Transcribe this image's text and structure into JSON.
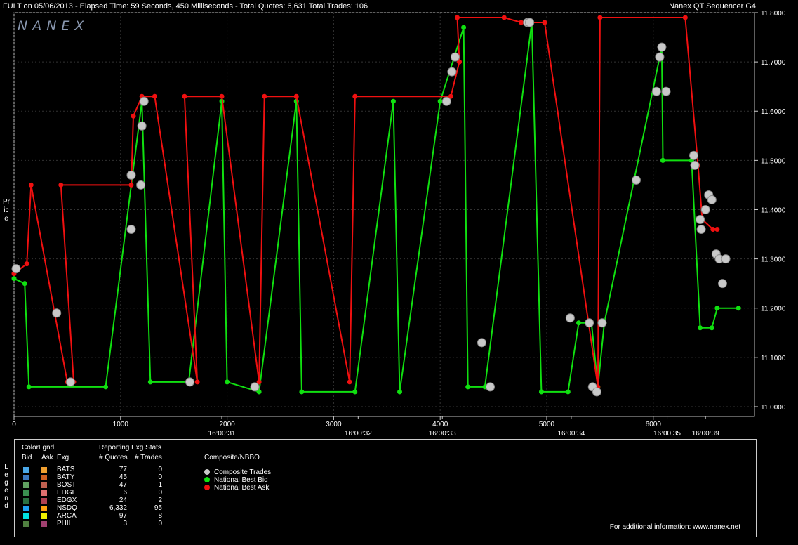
{
  "header": {
    "left": "FULT on 05/06/2013  -  Elapsed Time: 59 Seconds, 450 Milliseconds  -  Total Quotes: 6,631  Total Trades: 106",
    "right": "Nanex QT Sequencer G4",
    "logo": "NANEX"
  },
  "side_labels": {
    "price": "Price",
    "legend": "Legend"
  },
  "legend": {
    "colorlgnd": "ColorLgnd",
    "bid": "Bid",
    "ask": "Ask",
    "exg": "Exg",
    "stats_title": "Reporting Exg Stats",
    "quotes_hdr": "# Quotes",
    "trades_hdr": "# Trades",
    "composite_title": "Composite/NBBO",
    "exchanges": [
      {
        "name": "BATS",
        "quotes": "77",
        "trades": "0",
        "bid_color": "#4aa8e8",
        "ask_color": "#f0a030"
      },
      {
        "name": "BATY",
        "quotes": "45",
        "trades": "0",
        "bid_color": "#3a78c0",
        "ask_color": "#d06020"
      },
      {
        "name": "BOST",
        "quotes": "47",
        "trades": "1",
        "bid_color": "#60a060",
        "ask_color": "#c06050"
      },
      {
        "name": "EDGE",
        "quotes": "6",
        "trades": "0",
        "bid_color": "#3a9050",
        "ask_color": "#e07070"
      },
      {
        "name": "EDGX",
        "quotes": "24",
        "trades": "2",
        "bid_color": "#2a7040",
        "ask_color": "#b04050"
      },
      {
        "name": "NSDQ",
        "quotes": "6,332",
        "trades": "95",
        "bid_color": "#1ea0f0",
        "ask_color": "#ffa010"
      },
      {
        "name": "ARCA",
        "quotes": "97",
        "trades": "8",
        "bid_color": "#00e0e0",
        "ask_color": "#f0f000"
      },
      {
        "name": "PHIL",
        "quotes": "3",
        "trades": "0",
        "bid_color": "#508040",
        "ask_color": "#a04070"
      }
    ],
    "composite": [
      {
        "label": "Composite Trades",
        "color": "#c8c8c8"
      },
      {
        "label": "National Best Bid",
        "color": "#10e010"
      },
      {
        "label": "National Best Ask",
        "color": "#f01010"
      }
    ],
    "footer": "For additional information: www.nanex.net"
  },
  "chart_data": {
    "type": "line",
    "ylim": [
      10.98,
      11.8
    ],
    "xlim": [
      0,
      6950
    ],
    "y_ticks": [
      "11.0000",
      "11.1000",
      "11.2000",
      "11.3000",
      "11.4000",
      "11.5000",
      "11.6000",
      "11.7000",
      "11.8000"
    ],
    "x_ticks": [
      "0",
      "1000",
      "2000",
      "3000",
      "4000",
      "5000",
      "6000"
    ],
    "time_ticks": [
      {
        "x": 1950,
        "label": "16:00:31"
      },
      {
        "x": 3230,
        "label": "16:00:32"
      },
      {
        "x": 4020,
        "label": "16:00:33"
      },
      {
        "x": 5230,
        "label": "16:00:34"
      },
      {
        "x": 6130,
        "label": "16:00:35"
      },
      {
        "x": 6490,
        "label": "16:00:39"
      }
    ],
    "series": [
      {
        "name": "National Best Bid",
        "color": "#10e010",
        "points": [
          [
            0,
            11.26
          ],
          [
            100,
            11.25
          ],
          [
            140,
            11.04
          ],
          [
            860,
            11.04
          ],
          [
            1200,
            11.62
          ],
          [
            1280,
            11.05
          ],
          [
            1640,
            11.05
          ],
          [
            1950,
            11.62
          ],
          [
            2000,
            11.05
          ],
          [
            2300,
            11.03
          ],
          [
            2650,
            11.62
          ],
          [
            2700,
            11.03
          ],
          [
            3200,
            11.03
          ],
          [
            3560,
            11.62
          ],
          [
            3620,
            11.03
          ],
          [
            4000,
            11.62
          ],
          [
            4220,
            11.77
          ],
          [
            4260,
            11.04
          ],
          [
            4420,
            11.04
          ],
          [
            4860,
            11.78
          ],
          [
            4950,
            11.03
          ],
          [
            5200,
            11.03
          ],
          [
            5300,
            11.17
          ],
          [
            5420,
            11.17
          ],
          [
            5480,
            11.04
          ],
          [
            5540,
            11.17
          ],
          [
            6080,
            11.73
          ],
          [
            6090,
            11.5
          ],
          [
            6360,
            11.5
          ],
          [
            6440,
            11.16
          ],
          [
            6550,
            11.16
          ],
          [
            6600,
            11.2
          ],
          [
            6800,
            11.2
          ]
        ]
      },
      {
        "name": "National Best Ask",
        "color": "#f01010",
        "points": [
          [
            0,
            11.27
          ],
          [
            120,
            11.29
          ],
          [
            160,
            11.45
          ],
          [
            500,
            11.05
          ],
          [
            560,
            11.05
          ],
          [
            440,
            11.45
          ],
          [
            1100,
            11.45
          ],
          [
            1120,
            11.59
          ],
          [
            1200,
            11.63
          ],
          [
            1320,
            11.63
          ],
          [
            1720,
            11.05
          ],
          [
            1600,
            11.63
          ],
          [
            1950,
            11.63
          ],
          [
            2300,
            11.05
          ],
          [
            2350,
            11.63
          ],
          [
            2650,
            11.63
          ],
          [
            3150,
            11.05
          ],
          [
            3200,
            11.63
          ],
          [
            4100,
            11.63
          ],
          [
            4180,
            11.7
          ],
          [
            4160,
            11.79
          ],
          [
            4600,
            11.79
          ],
          [
            4760,
            11.78
          ],
          [
            4980,
            11.78
          ],
          [
            5480,
            11.04
          ],
          [
            5500,
            11.79
          ],
          [
            6300,
            11.79
          ],
          [
            6420,
            11.49
          ],
          [
            6460,
            11.38
          ],
          [
            6560,
            11.36
          ],
          [
            6600,
            11.36
          ]
        ]
      }
    ],
    "trades": [
      [
        20,
        11.28
      ],
      [
        400,
        11.19
      ],
      [
        530,
        11.05
      ],
      [
        1100,
        11.36
      ],
      [
        1100,
        11.47
      ],
      [
        1190,
        11.45
      ],
      [
        1200,
        11.57
      ],
      [
        1220,
        11.62
      ],
      [
        1650,
        11.05
      ],
      [
        2260,
        11.04
      ],
      [
        4060,
        11.62
      ],
      [
        4110,
        11.68
      ],
      [
        4140,
        11.71
      ],
      [
        4390,
        11.13
      ],
      [
        4470,
        11.04
      ],
      [
        4820,
        11.78
      ],
      [
        4840,
        11.78
      ],
      [
        5220,
        11.18
      ],
      [
        5400,
        11.17
      ],
      [
        5430,
        11.04
      ],
      [
        5470,
        11.03
      ],
      [
        5520,
        11.17
      ],
      [
        5840,
        11.46
      ],
      [
        6030,
        11.64
      ],
      [
        6060,
        11.71
      ],
      [
        6080,
        11.73
      ],
      [
        6120,
        11.64
      ],
      [
        6380,
        11.51
      ],
      [
        6390,
        11.49
      ],
      [
        6440,
        11.38
      ],
      [
        6450,
        11.36
      ],
      [
        6490,
        11.4
      ],
      [
        6520,
        11.43
      ],
      [
        6550,
        11.42
      ],
      [
        6590,
        11.31
      ],
      [
        6620,
        11.3
      ],
      [
        6650,
        11.25
      ],
      [
        6680,
        11.3
      ]
    ]
  }
}
